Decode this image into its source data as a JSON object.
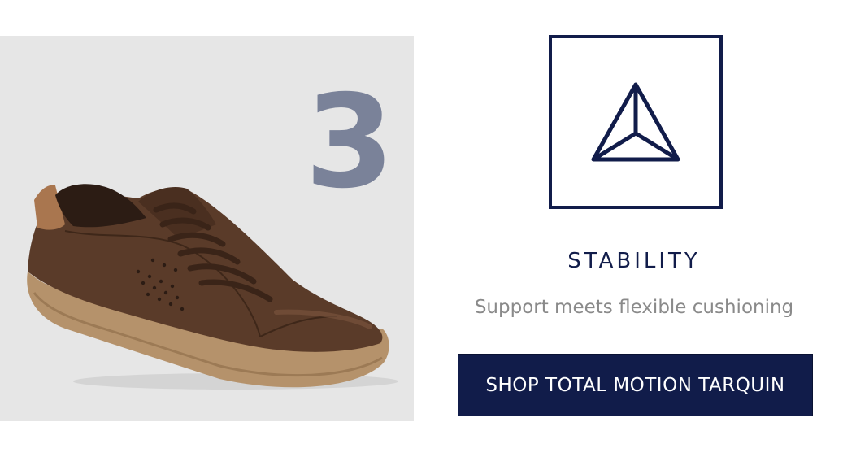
{
  "product": {
    "step_number": "3",
    "image_alt": "brown leather sneaker with tan sole"
  },
  "feature": {
    "icon": "triangle-stability-icon",
    "title": "STABILITY",
    "description": "Support meets flexible cushioning"
  },
  "cta": {
    "label": "SHOP TOTAL MOTION TARQUIN"
  },
  "colors": {
    "navy": "#111c4a",
    "number_gray": "#7a8299",
    "panel_bg": "#e6e6e6",
    "desc_gray": "#8a8a8a"
  }
}
